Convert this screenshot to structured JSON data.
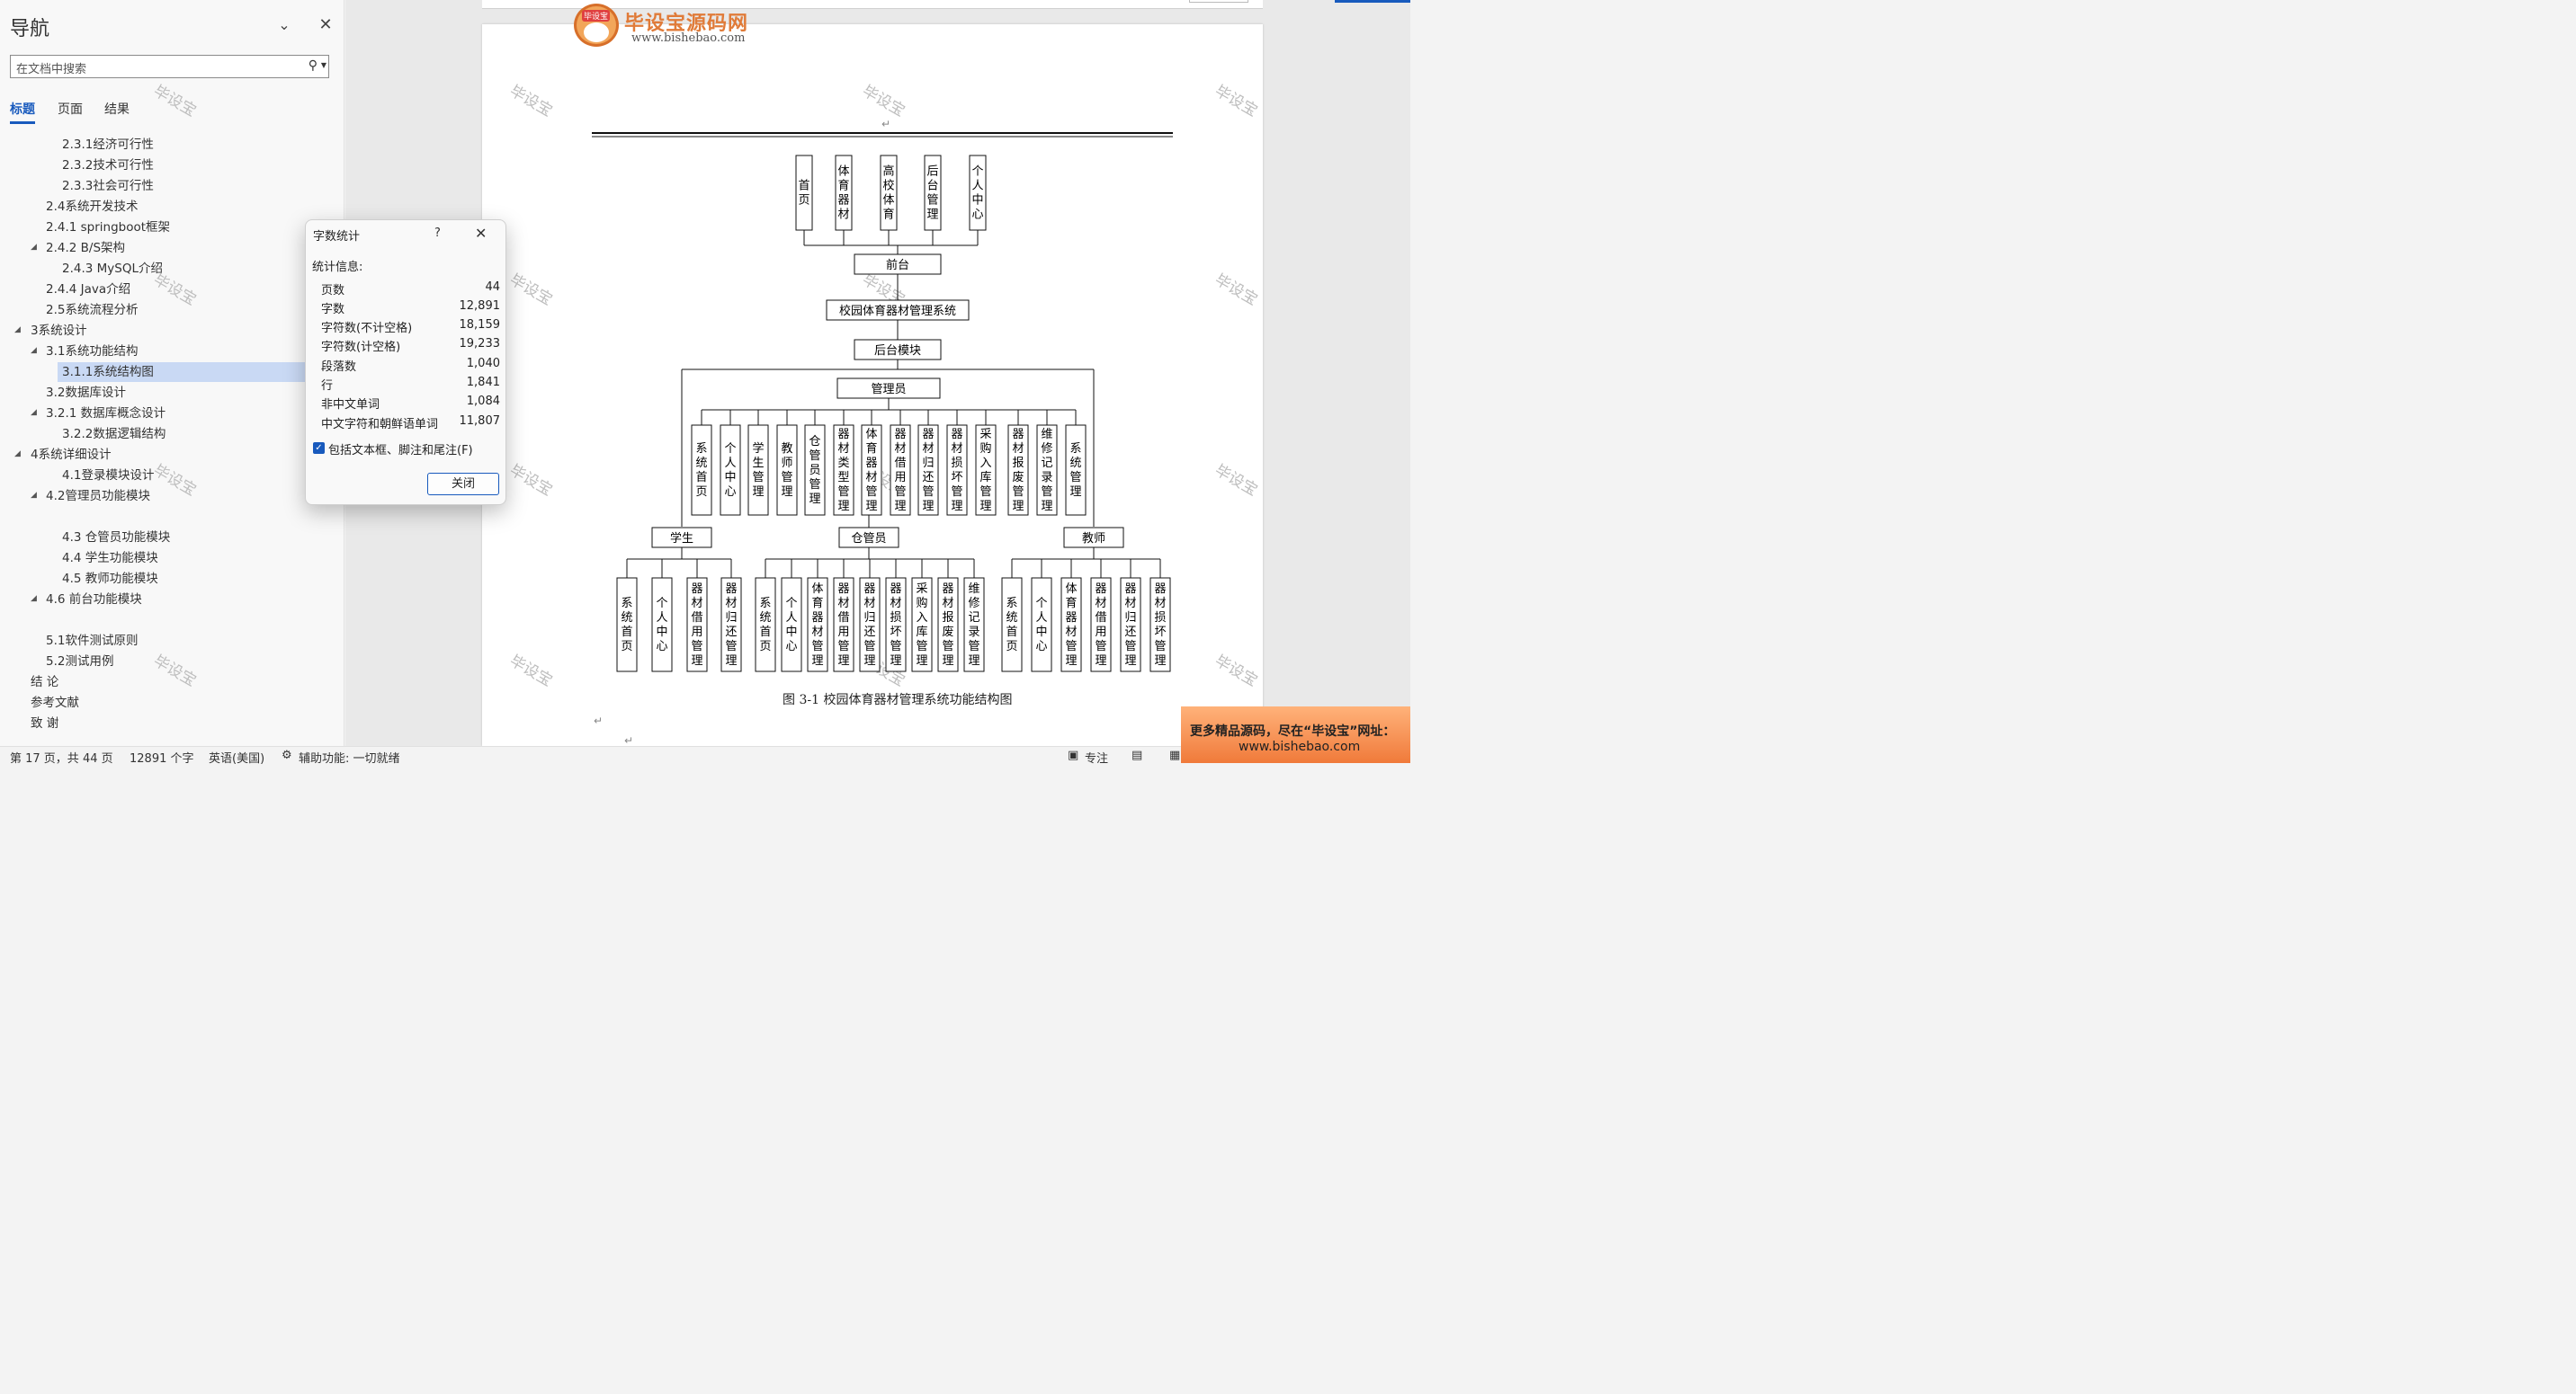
{
  "nav": {
    "title": "导航",
    "search_placeholder": "在文档中搜索",
    "tabs": [
      "标题",
      "页面",
      "结果"
    ],
    "items": [
      "2.3.1经济可行性",
      "2.3.2技术可行性",
      "2.3.3社会可行性",
      "2.4系统开发技术",
      "2.4.1 springboot框架",
      "2.4.2 B/S架构",
      "2.4.3 MySQL介绍",
      "2.4.4 Java介绍",
      "2.5系统流程分析",
      "3系统设计",
      "3.1系统功能结构",
      "3.1.1系统结构图",
      "3.2数据库设计",
      "3.2.1 数据库概念设计",
      "3.2.2数据逻辑结构",
      "4系统详细设计",
      "4.1登录模块设计",
      "4.2管理员功能模块",
      "4.3 仓管员功能模块",
      "4.4 学生功能模块",
      "4.5 教师功能模块",
      "4.6 前台功能模块",
      "5.1软件测试原则",
      "5.2测试用例",
      "结  论",
      "参考文献",
      "致  谢"
    ]
  },
  "dialog": {
    "title": "字数统计",
    "help": "?",
    "stats_label": "统计信息:",
    "stats": [
      {
        "label": "页数",
        "value": "44"
      },
      {
        "label": "字数",
        "value": "12,891"
      },
      {
        "label": "字符数(不计空格)",
        "value": "18,159"
      },
      {
        "label": "字符数(计空格)",
        "value": "19,233"
      },
      {
        "label": "段落数",
        "value": "1,040"
      },
      {
        "label": "行",
        "value": "1,841"
      },
      {
        "label": "非中文单词",
        "value": "1,084"
      },
      {
        "label": "中文字符和朝鲜语单词",
        "value": "11,807"
      }
    ],
    "checkbox_label": "包括文本框、脚注和尾注(F)",
    "close_button": "关闭"
  },
  "logo": {
    "badge": "毕设宝",
    "title": "毕设宝源码网",
    "url": "www.bishebao.com"
  },
  "watermark": "毕设宝",
  "diagram": {
    "top_modules": [
      "首页",
      "体育器材",
      "高校体育",
      "后台管理",
      "个人中心"
    ],
    "frontend": "前台",
    "system": "校园体育器材管理系统",
    "backend": "后台模块",
    "admin": "管理员",
    "admin_modules": [
      "系统首页",
      "个人中心",
      "学生管理",
      "教师管理",
      "仓管员管理",
      "器材类型管理",
      "体育器材管理",
      "器材借用管理",
      "器材归还管理",
      "器材损坏管理",
      "采购入库管理",
      "器材报废管理",
      "维修记录管理",
      "系统管理"
    ],
    "roles": [
      "学生",
      "仓管员",
      "教师"
    ],
    "student_modules": [
      "系统首页",
      "个人中心",
      "器材借用管理",
      "器材归还管理"
    ],
    "keeper_modules": [
      "系统首页",
      "个人中心",
      "体育器材管理",
      "器材借用管理",
      "器材归还管理",
      "器材损坏管理",
      "采购入库管理",
      "器材报废管理",
      "维修记录管理"
    ],
    "teacher_modules": [
      "系统首页",
      "个人中心",
      "体育器材管理",
      "器材借用管理",
      "器材归还管理",
      "器材损坏管理"
    ]
  },
  "caption": "图 3-1  校园体育器材管理系统功能结构图",
  "status_bar": {
    "page": "第 17 页，共 44 页",
    "words": "12891 个字",
    "language": "英语(美国)",
    "accessibility": "辅助功能: 一切就绪",
    "focus": "专注"
  },
  "ad": {
    "line1": "更多精品源码，尽在“毕设宝”网址：",
    "line2": "www.bishebao.com"
  }
}
